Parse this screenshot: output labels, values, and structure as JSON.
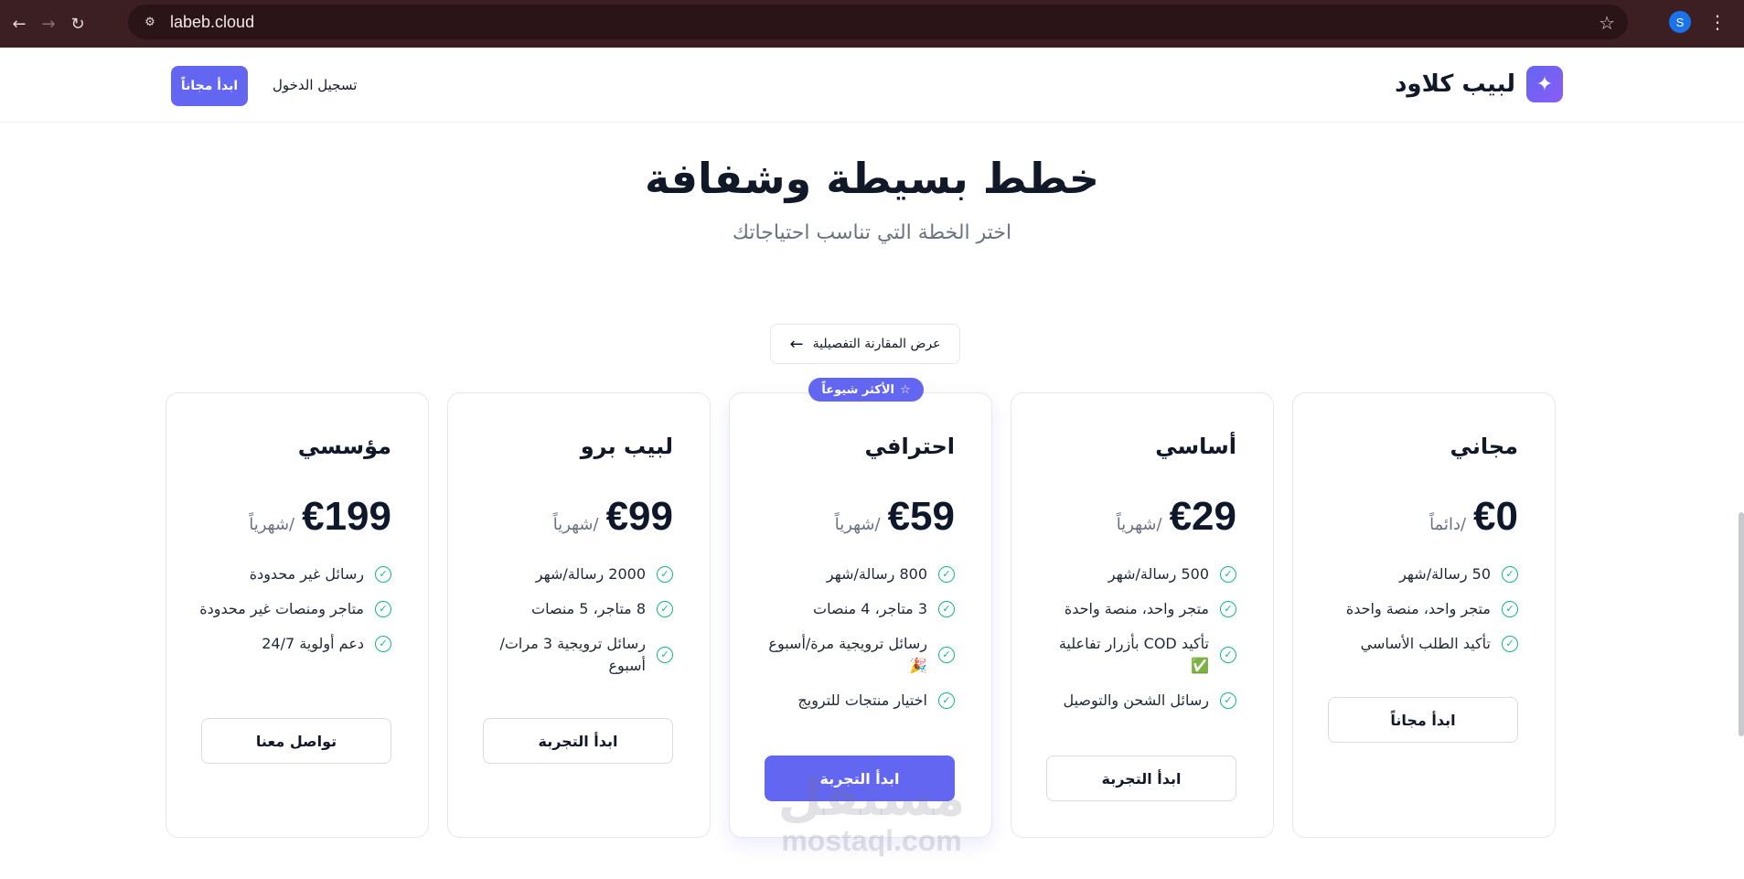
{
  "browser": {
    "url": "labeb.cloud",
    "profile_initial": "S"
  },
  "header": {
    "brand_name": "لبيب كلاود",
    "login_label": "تسجيل الدخول",
    "start_label": "ابدأ مجاناً"
  },
  "hero": {
    "title": "خطط بسيطة وشفافة",
    "subtitle": "اختر الخطة التي تناسب احتياجاتك"
  },
  "compare_label": "عرض المقارنة التفصيلية",
  "popular_badge": "الأكثر شيوعاً",
  "plans": [
    {
      "name": "مجاني",
      "price": "€0",
      "period": "/دائماً",
      "features": [
        "50 رسالة/شهر",
        "متجر واحد، منصة واحدة",
        "تأكيد الطلب الأساسي"
      ],
      "cta": "ابدأ مجاناً"
    },
    {
      "name": "أساسي",
      "price": "€29",
      "period": "/شهرياً",
      "features": [
        "500 رسالة/شهر",
        "متجر واحد، منصة واحدة",
        "تأكيد COD بأزرار تفاعلية ✅",
        "رسائل الشحن والتوصيل"
      ],
      "cta": "ابدأ التجربة"
    },
    {
      "name": "احترافي",
      "price": "€59",
      "period": "/شهرياً",
      "features": [
        "800 رسالة/شهر",
        "3 متاجر، 4 منصات",
        "رسائل ترويجية مرة/أسبوع 🎉",
        "اختيار منتجات للترويج"
      ],
      "cta": "ابدأ التجربة"
    },
    {
      "name": "لبيب برو",
      "price": "€99",
      "period": "/شهرياً",
      "features": [
        "2000 رسالة/شهر",
        "8 متاجر، 5 منصات",
        "رسائل ترويجية 3 مرات/أسبوع"
      ],
      "cta": "ابدأ التجربة"
    },
    {
      "name": "مؤسسي",
      "price": "€199",
      "period": "/شهرياً",
      "features": [
        "رسائل غير محدودة",
        "متاجر ومنصات غير محدودة",
        "دعم أولوية 24/7"
      ],
      "cta": "تواصل معنا"
    }
  ],
  "watermark": {
    "arabic": "مستقل",
    "latin": "mostaql.com"
  },
  "icons": {
    "brand": "sparkles-icon",
    "check": "check-circle-icon",
    "badge": "star-icon",
    "compare": "arrow-left-icon"
  },
  "colors": {
    "accent": "#6366f1",
    "check": "#10b981",
    "chrome": "#3b1f23"
  }
}
